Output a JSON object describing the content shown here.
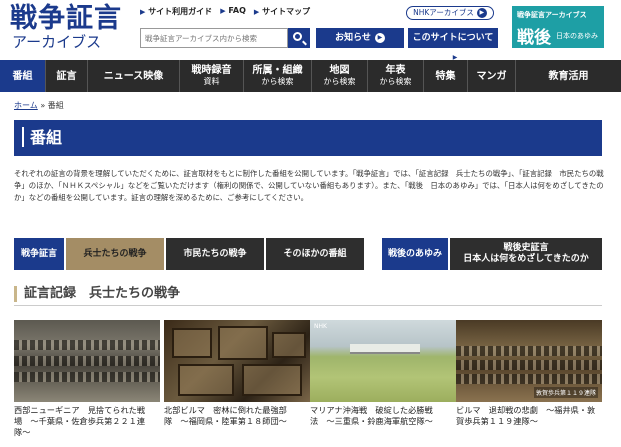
{
  "header": {
    "logo_main": "戦争証言",
    "logo_sub": "アーカイブス",
    "top_links": [
      "サイト利用ガイド",
      "FAQ",
      "サイトマップ"
    ],
    "nhk_archives": "NHKアーカイブス",
    "search_placeholder": "戦争証言アーカイブス内から検索",
    "notice_button": "お知らせ",
    "about_button": "このサイトについて",
    "banner_sub": "戦争証言アーカイブス",
    "banner_big": "戦後",
    "banner_small": "日本のあゆみ"
  },
  "nav": {
    "items": [
      {
        "label": "番組",
        "sub": ""
      },
      {
        "label": "証言",
        "sub": ""
      },
      {
        "label": "ニュース映像",
        "sub": ""
      },
      {
        "label": "戦時録音",
        "sub": "資料"
      },
      {
        "label": "所属・組織",
        "sub": "から検索"
      },
      {
        "label": "地図",
        "sub": "から検索"
      },
      {
        "label": "年表",
        "sub": "から検索"
      },
      {
        "label": "特集",
        "sub": ""
      },
      {
        "label": "マンガ",
        "sub": ""
      },
      {
        "label": "教育活用",
        "sub": ""
      }
    ]
  },
  "breadcrumb": {
    "home": "ホーム",
    "separator": "»",
    "current": "番組"
  },
  "page_title": "番組",
  "intro": "それぞれの証言の背景を理解していただくために、証言取材をもとに制作した番組を公開しています。「戦争証言」では、「証言記録　兵士たちの戦争」、「証言記録　市民たちの戦争」のほか、「ＮＨＫスペシャル」などをご覧いただけます（権利の関係で、公開していない番組もあります）。また、「戦後　日本のあゆみ」では、「日本人は何をめざしてきたのか」などの番組を公開しています。証言の理解を深めるために、ご参考にしてください。",
  "tabs": {
    "senso": "戦争証言",
    "heishi": "兵士たちの戦争",
    "shimin": "市民たちの戦争",
    "hoka": "そのほかの番組",
    "sengo": "戦後のあゆみ",
    "sengoshi_line1": "戦後史証言",
    "sengoshi_line2": "日本人は何をめざしてきたのか"
  },
  "section_title": "証言記録　兵士たちの戦争",
  "cards": [
    {
      "caption": "西部ニューギニア　見捨てられた戦場　〜千葉県・佐倉歩兵第２２１連隊〜",
      "overlay": ""
    },
    {
      "caption": "北部ビルマ　密林に倒れた最強部隊　〜福岡県・陸軍第１８師団〜",
      "overlay": ""
    },
    {
      "caption": "マリアナ沖海戦　破綻した必勝戦法　〜三重県・鈴鹿海軍航空隊〜",
      "overlay": "NHK"
    },
    {
      "caption": "ビルマ　退却戦の悲劇　〜福井県・敦賀歩兵第１１９連隊〜",
      "overlay": "敦賀歩兵第１１９連隊"
    }
  ]
}
